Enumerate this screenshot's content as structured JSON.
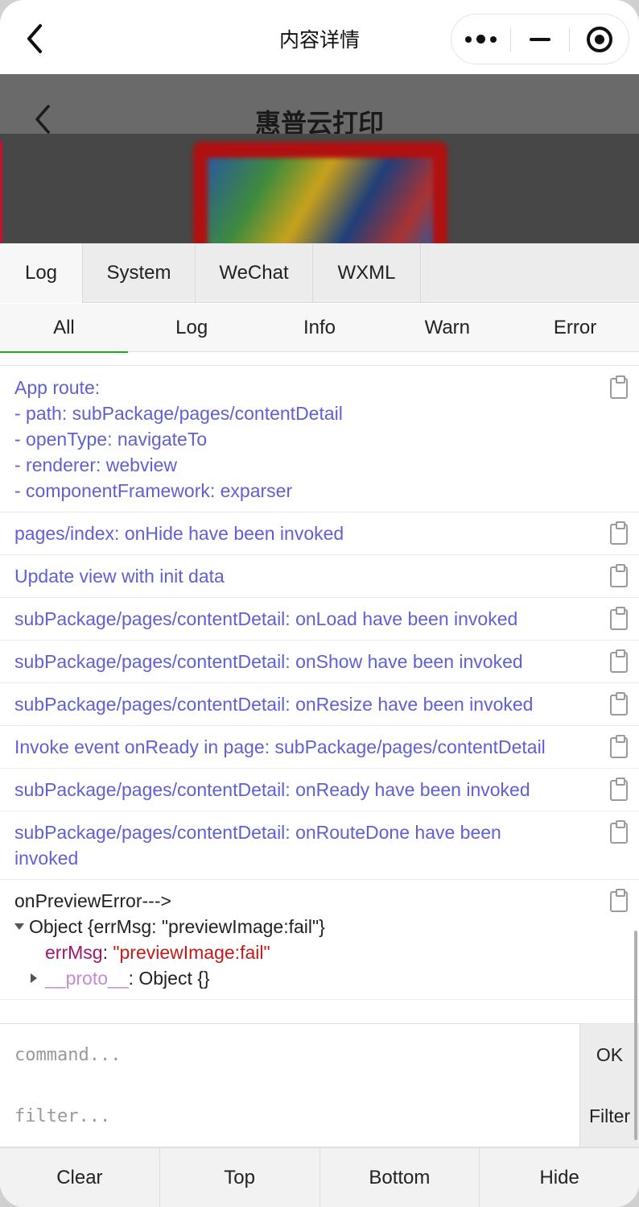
{
  "navbar": {
    "title": "内容详情",
    "capsule": {
      "more_icon": "more-dots-icon",
      "minimize_icon": "minimize-icon",
      "close_icon": "target-icon"
    }
  },
  "background_page": {
    "title": "惠普云打印"
  },
  "vconsole": {
    "tabs": [
      {
        "label": "Log",
        "active": true
      },
      {
        "label": "System",
        "active": false
      },
      {
        "label": "WeChat",
        "active": false
      },
      {
        "label": "WXML",
        "active": false
      }
    ],
    "subtabs": [
      {
        "label": "All",
        "active": true
      },
      {
        "label": "Log",
        "active": false
      },
      {
        "label": "Info",
        "active": false
      },
      {
        "label": "Warn",
        "active": false
      },
      {
        "label": "Error",
        "active": false
      }
    ],
    "logs": [
      {
        "lines": [
          "App route:",
          "- path: subPackage/pages/contentDetail",
          "- openType: navigateTo",
          "- renderer: webview",
          "- componentFramework: exparser"
        ]
      },
      {
        "lines": [
          "pages/index: onHide have been invoked"
        ]
      },
      {
        "lines": [
          "Update view with init data"
        ]
      },
      {
        "lines": [
          "subPackage/pages/contentDetail: onLoad have been invoked"
        ]
      },
      {
        "lines": [
          "subPackage/pages/contentDetail: onShow have been invoked"
        ]
      },
      {
        "lines": [
          "subPackage/pages/contentDetail: onResize have been invoked"
        ]
      },
      {
        "lines": [
          "Invoke event onReady in page: subPackage/pages/contentDetail"
        ]
      },
      {
        "lines": [
          "subPackage/pages/contentDetail: onReady have been invoked"
        ]
      },
      {
        "lines": [
          "subPackage/pages/contentDetail: onRouteDone have been",
          "invoked"
        ]
      }
    ],
    "error_log": {
      "title": "onPreviewError--->",
      "object_summary": "Object {errMsg: \"previewImage:fail\"}",
      "key": "errMsg",
      "value": "\"previewImage:fail\"",
      "proto_key": "__proto__",
      "proto_value": ": Object {}"
    },
    "command": {
      "placeholder": "command...",
      "button": "OK"
    },
    "filter": {
      "placeholder": "filter...",
      "button": "Filter"
    },
    "toolbar": [
      "Clear",
      "Top",
      "Bottom",
      "Hide"
    ]
  },
  "colors": {
    "log_text": "#5f5fd6",
    "active_underline": "#1aad19",
    "error_value": "#c41a16",
    "object_key": "#a0156e"
  }
}
